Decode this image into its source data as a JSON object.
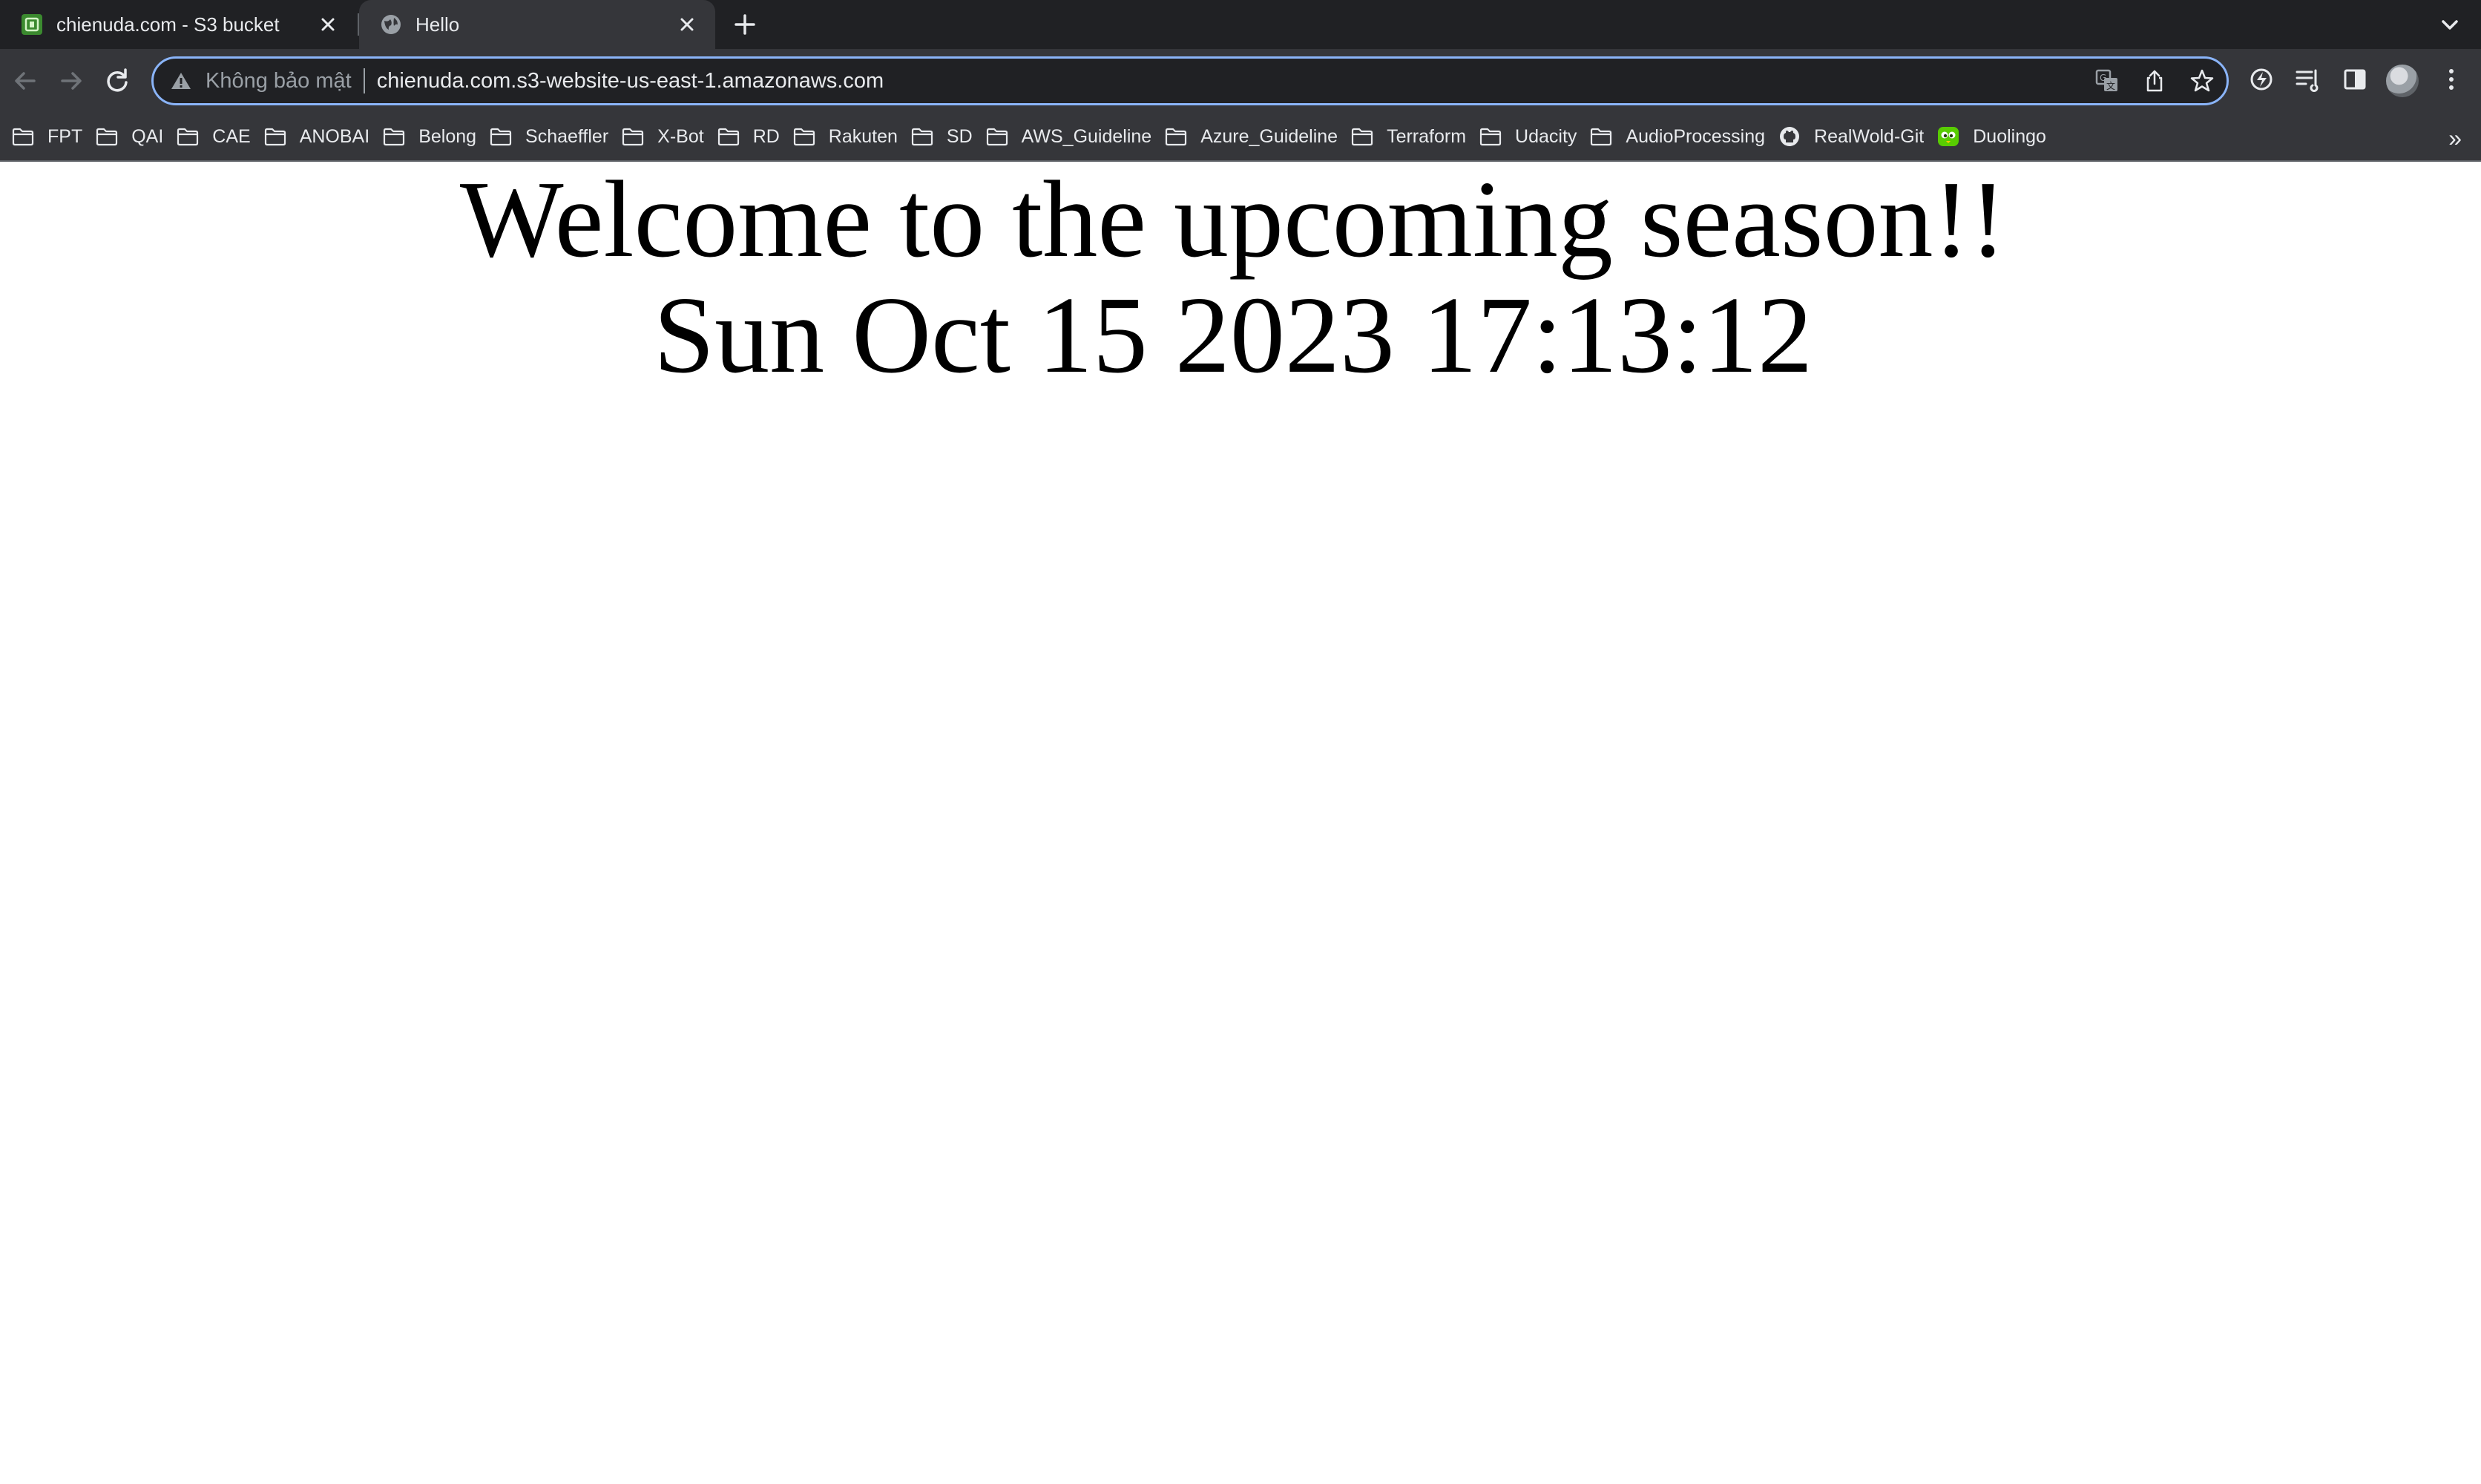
{
  "browser": {
    "tabs": [
      {
        "title": "chienuda.com - S3 bucket",
        "active": false,
        "favicon": "s3-bucket-icon"
      },
      {
        "title": "Hello",
        "active": true,
        "favicon": "globe-icon"
      }
    ],
    "address_bar": {
      "security_label": "Không bảo mật",
      "url": "chienuda.com.s3-website-us-east-1.amazonaws.com"
    },
    "bookmarks": [
      {
        "label": "FPT",
        "icon": "folder-icon"
      },
      {
        "label": "QAI",
        "icon": "folder-icon"
      },
      {
        "label": "CAE",
        "icon": "folder-icon"
      },
      {
        "label": "ANOBAI",
        "icon": "folder-icon"
      },
      {
        "label": "Belong",
        "icon": "folder-icon"
      },
      {
        "label": "Schaeffler",
        "icon": "folder-icon"
      },
      {
        "label": "X-Bot",
        "icon": "folder-icon"
      },
      {
        "label": "RD",
        "icon": "folder-icon"
      },
      {
        "label": "Rakuten",
        "icon": "folder-icon"
      },
      {
        "label": "SD",
        "icon": "folder-icon"
      },
      {
        "label": "AWS_Guideline",
        "icon": "folder-icon"
      },
      {
        "label": "Azure_Guideline",
        "icon": "folder-icon"
      },
      {
        "label": "Terraform",
        "icon": "folder-icon"
      },
      {
        "label": "Udacity",
        "icon": "folder-icon"
      },
      {
        "label": "AudioProcessing",
        "icon": "folder-icon"
      },
      {
        "label": "RealWold-Git",
        "icon": "github-icon"
      },
      {
        "label": "Duolingo",
        "icon": "duolingo-icon"
      }
    ],
    "overflow_label": "»",
    "colors": {
      "frame": "#202124",
      "toolbar": "#35363a",
      "focus_ring": "#8ab4f8",
      "text": "#e8eaed"
    }
  },
  "page": {
    "heading": "Welcome to the upcoming season!!",
    "datetime": "Sun Oct 15 2023 17:13:12"
  }
}
